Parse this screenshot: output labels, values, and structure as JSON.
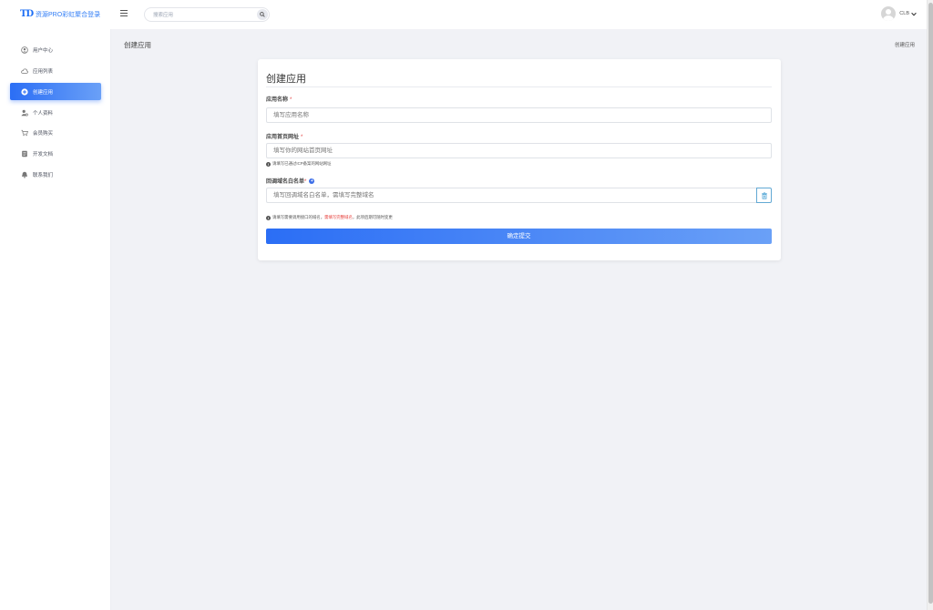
{
  "header": {
    "logo_mark": "TD",
    "logo_text": "资源PRO彩虹聚合登录",
    "search_placeholder": "搜索应用",
    "user_name": "CLB"
  },
  "sidebar": {
    "items": [
      {
        "label": "用户中心",
        "icon": "user-circle-icon",
        "active": false
      },
      {
        "label": "应用列表",
        "icon": "cloud-icon",
        "active": false
      },
      {
        "label": "创建应用",
        "icon": "plus-circle-icon",
        "active": true
      },
      {
        "label": "个人资料",
        "icon": "user-gear-icon",
        "active": false
      },
      {
        "label": "会员购买",
        "icon": "cart-icon",
        "active": false
      },
      {
        "label": "开发文档",
        "icon": "document-icon",
        "active": false
      },
      {
        "label": "联系我们",
        "icon": "bell-icon",
        "active": false
      }
    ]
  },
  "page": {
    "title": "创建应用",
    "breadcrumb": "创建应用"
  },
  "form": {
    "title": "创建应用",
    "app_name_label": "应用名称",
    "app_name_placeholder": "填写应用名称",
    "homepage_label": "应用首页网址",
    "homepage_placeholder": "填写你的网站首页网址",
    "homepage_help": "请填写已通过ICP备案的网站网址",
    "callback_label": "回调域名白名单",
    "callback_placeholder": "填写回调域名白名单，需填写完整域名",
    "callback_help_1": "请填写需要调用接口的域名，",
    "callback_help_red": "需填写完整域名",
    "callback_help_2": "，此项后期可随时变更",
    "required_mark": "*",
    "submit_label": "确定提交"
  },
  "colors": {
    "accent": "#2b6ef5",
    "accent_light": "#6aa0f7",
    "required": "#e54646",
    "background": "#f1f2f6"
  }
}
